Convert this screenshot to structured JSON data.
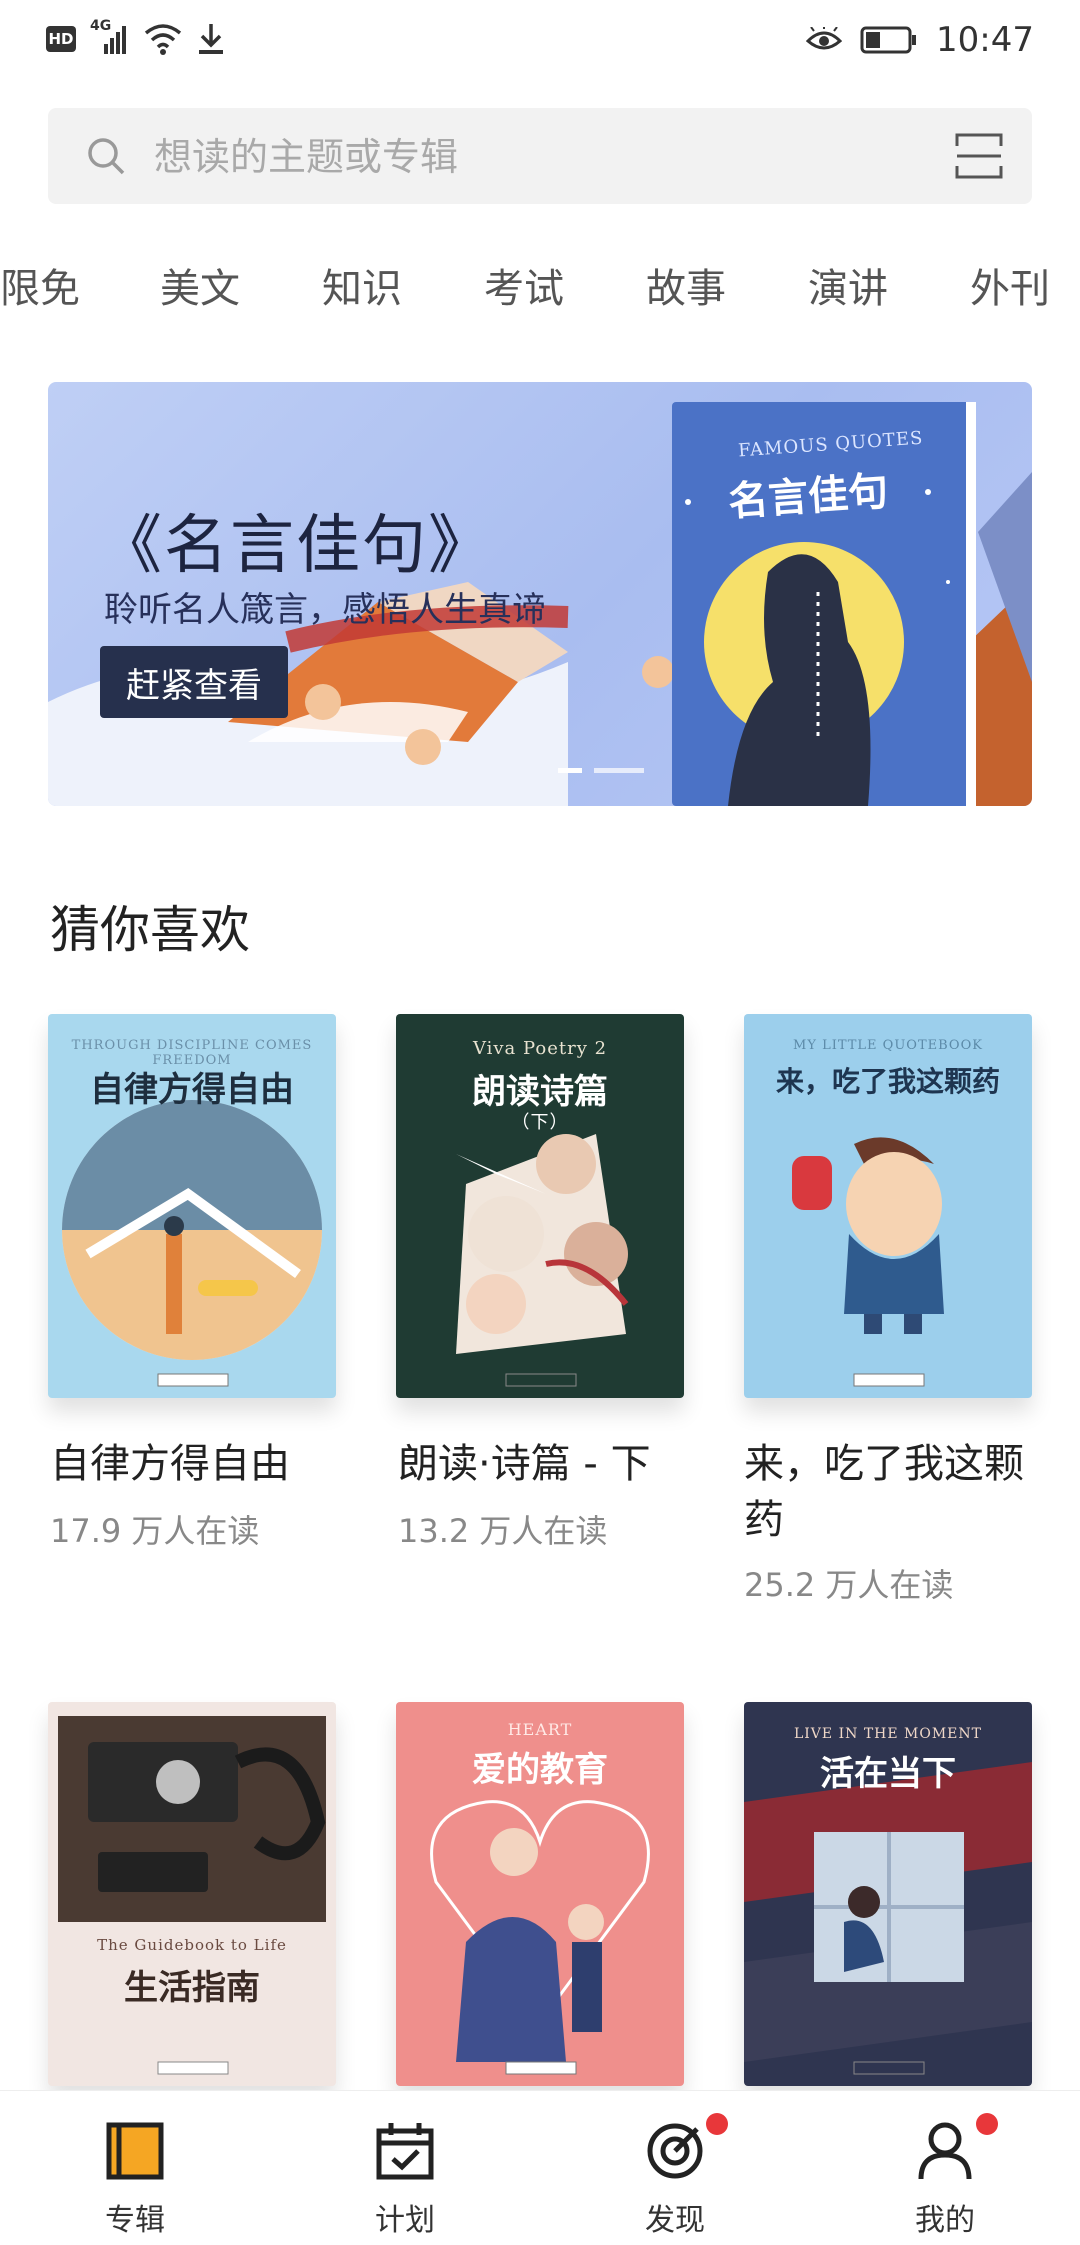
{
  "status_bar": {
    "left_icons": [
      "hd-badge",
      "signal-4g-icon",
      "wifi-icon",
      "download-icon"
    ],
    "hd_label": "HD",
    "network_label": "4G",
    "right_icons": [
      "eye-icon",
      "battery-icon"
    ],
    "time": "10:47"
  },
  "search": {
    "placeholder": "想读的主题或专辑",
    "search_icon": "search-icon",
    "scan_icon": "scan-icon"
  },
  "tabs": [
    "限免",
    "美文",
    "知识",
    "考试",
    "故事",
    "演讲",
    "外刊"
  ],
  "banner": {
    "title": "《名言佳句》",
    "subtitle": "聆听名人箴言，感悟人生真谛",
    "button": "赶紧查看",
    "book_title": "名言佳句",
    "book_subtitle": "FAMOUS QUOTES"
  },
  "section_title": "猜你喜欢",
  "albums": [
    {
      "name": "自律方得自由",
      "reads": "17.9 万人在读",
      "cover_title": "自律方得自由",
      "cover_sub": "THROUGH DISCIPLINE COMES FREEDOM",
      "bg": "#a9d8ee"
    },
    {
      "name": "朗读·诗篇 - 下",
      "reads": "13.2 万人在读",
      "cover_title": "朗读诗篇",
      "cover_sub": "Viva Poetry 2",
      "cover_extra": "（下）",
      "bg": "#1f3b33"
    },
    {
      "name": "来，吃了我这颗药",
      "reads": "25.2 万人在读",
      "cover_title": "来，吃了我这颗药",
      "cover_sub": "MY LITTLE QUOTEBOOK",
      "bg": "#9ccfec"
    },
    {
      "name": "",
      "reads": "",
      "cover_title": "生活指南",
      "cover_sub": "The Guidebook to Life",
      "bg": "#f1e6e2"
    },
    {
      "name": "",
      "reads": "",
      "cover_title": "爱的教育",
      "cover_sub": "HEART",
      "bg": "#ef8f8c"
    },
    {
      "name": "",
      "reads": "",
      "cover_title": "活在当下",
      "cover_sub": "LIVE IN THE MOMENT",
      "bg": "#2f3550"
    }
  ],
  "publisher_stamp": "晋诗堂·童阅读",
  "bottom_nav": [
    {
      "label": "专辑",
      "icon": "album-icon",
      "active": true,
      "badge": false
    },
    {
      "label": "计划",
      "icon": "calendar-check-icon",
      "active": false,
      "badge": false
    },
    {
      "label": "发现",
      "icon": "target-icon",
      "active": false,
      "badge": true
    },
    {
      "label": "我的",
      "icon": "user-icon",
      "active": false,
      "badge": true
    }
  ],
  "colors": {
    "accent": "#f5a623",
    "badge": "#e8373a",
    "search_bg": "#f2f2f2",
    "banner_button": "#26304d"
  }
}
